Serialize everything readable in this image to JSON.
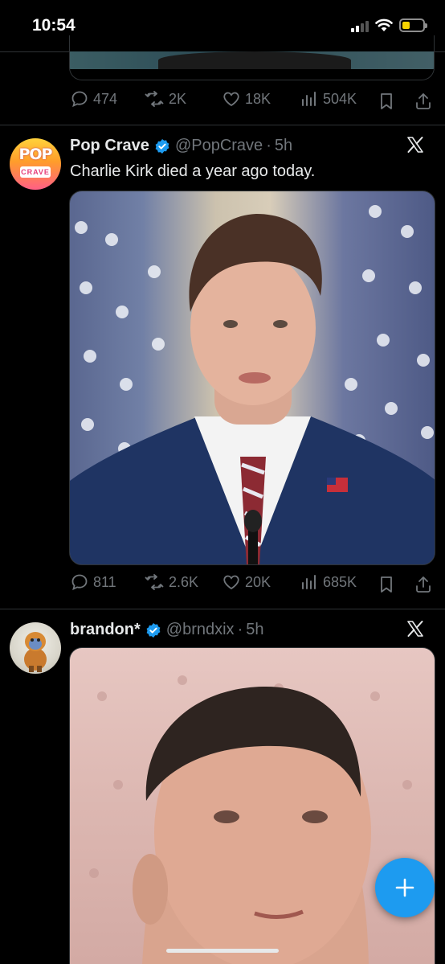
{
  "status_bar": {
    "time": "10:54",
    "battery_color": "#f7d400"
  },
  "previous_tweet": {
    "actions": {
      "replies": "474",
      "reposts": "2K",
      "likes": "18K",
      "views": "504K"
    }
  },
  "tweet1": {
    "avatar_text": {
      "top": "POP",
      "bottom": "CRAVE"
    },
    "name": "Pop Crave",
    "handle": "@PopCrave",
    "separator": "·",
    "time": "5h",
    "text": "Charlie Kirk died a year ago today.",
    "actions": {
      "replies": "811",
      "reposts": "2.6K",
      "likes": "20K",
      "views": "685K"
    }
  },
  "tweet2": {
    "name": "brandon*",
    "handle": "@brndxix",
    "separator": "·",
    "time": "5h"
  },
  "icons": {
    "reply": "reply-icon",
    "repost": "repost-icon",
    "like": "like-icon",
    "views": "views-icon",
    "bookmark": "bookmark-icon",
    "share": "share-icon",
    "verified": "verified-badge-icon",
    "x_logo": "x-logo-icon",
    "compose": "plus-icon"
  },
  "colors": {
    "accent": "#1d9bf0",
    "background": "#000000",
    "muted": "#71767b",
    "text": "#e7e9ea"
  }
}
